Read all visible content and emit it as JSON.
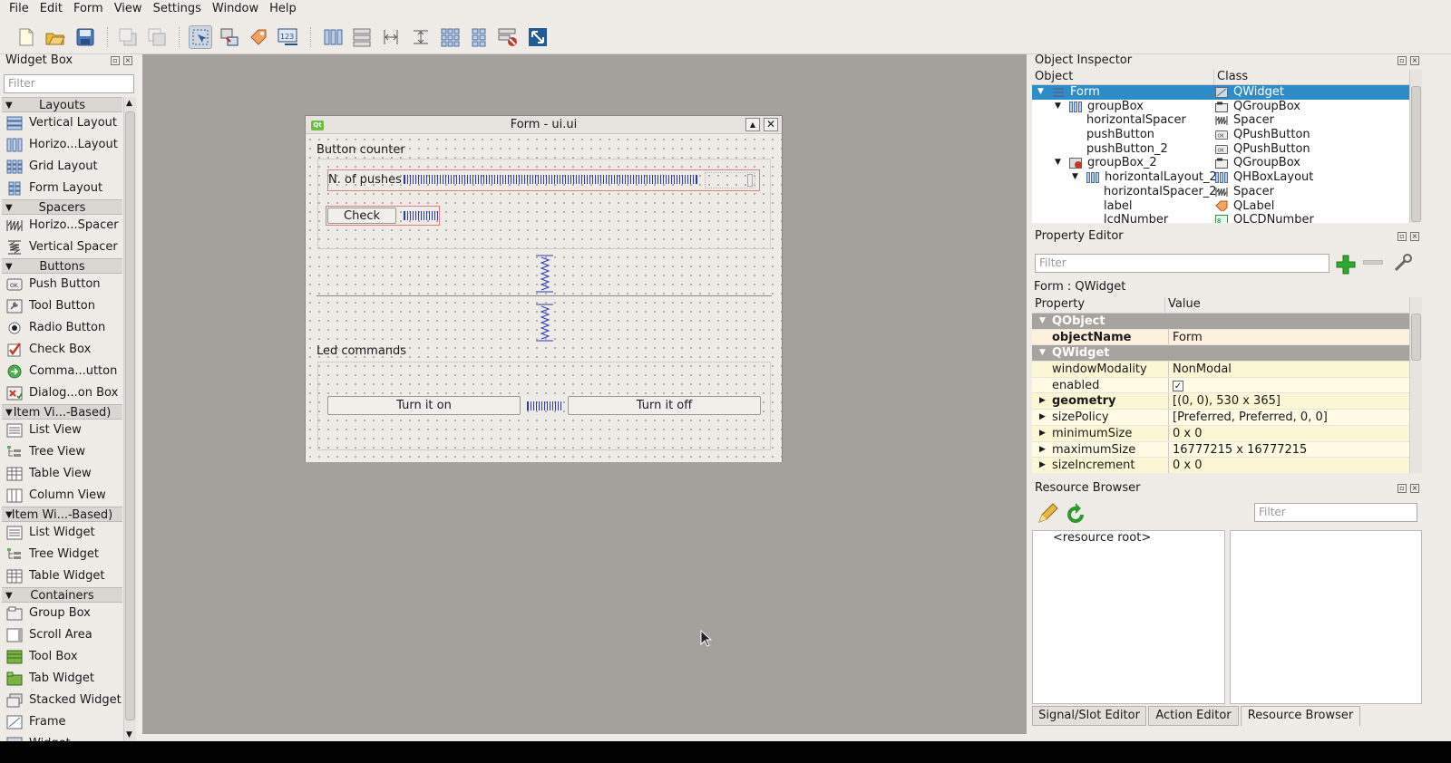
{
  "menubar": [
    "File",
    "Edit",
    "Form",
    "View",
    "Settings",
    "Window",
    "Help"
  ],
  "toolbar_icons": [
    "new-file-icon",
    "open-file-icon",
    "save-icon",
    "send-to-back-icon",
    "bring-to-front-icon",
    "edit-widgets-icon",
    "edit-signals-icon",
    "edit-buddies-icon",
    "edit-tab-order-icon",
    "layout-horizontal-icon",
    "layout-vertical-icon",
    "layout-h-splitter-icon",
    "layout-v-splitter-icon",
    "layout-grid-icon",
    "layout-form-icon",
    "break-layout-icon",
    "adjust-size-icon"
  ],
  "widget_box": {
    "title": "Widget Box",
    "filter_placeholder": "Filter",
    "categories": [
      {
        "label": "Layouts",
        "items": [
          "Vertical Layout",
          "Horizo...Layout",
          "Grid Layout",
          "Form Layout"
        ]
      },
      {
        "label": "Spacers",
        "items": [
          "Horizo...Spacer",
          "Vertical Spacer"
        ]
      },
      {
        "label": "Buttons",
        "items": [
          "Push Button",
          "Tool Button",
          "Radio Button",
          "Check Box",
          "Comma...utton",
          "Dialog...on Box"
        ]
      },
      {
        "label": "Item Vi...-Based)",
        "items": [
          "List View",
          "Tree View",
          "Table View",
          "Column View"
        ]
      },
      {
        "label": "Item Wi...-Based)",
        "items": [
          "List Widget",
          "Tree Widget",
          "Table Widget"
        ]
      },
      {
        "label": "Containers",
        "items": [
          "Group Box",
          "Scroll Area",
          "Tool Box",
          "Tab Widget",
          "Stacked Widget",
          "Frame",
          "Widget"
        ]
      }
    ]
  },
  "form": {
    "title": "Form - ui.ui",
    "group1_title": "Button counter",
    "label_pushes": "N. of pushes",
    "check_button": "Check",
    "group2_title": "Led commands",
    "turn_on_button": "Turn it on",
    "turn_off_button": "Turn it off"
  },
  "object_inspector": {
    "title": "Object Inspector",
    "col_object": "Object",
    "col_class": "Class",
    "rows": [
      {
        "name": "Form",
        "cls": "QWidget",
        "depth": 0,
        "expander": "▼",
        "selected": true
      },
      {
        "name": "groupBox",
        "cls": "QGroupBox",
        "depth": 1,
        "expander": "▼"
      },
      {
        "name": "horizontalSpacer",
        "cls": "Spacer",
        "depth": 2,
        "expander": ""
      },
      {
        "name": "pushButton",
        "cls": "QPushButton",
        "depth": 2,
        "expander": ""
      },
      {
        "name": "pushButton_2",
        "cls": "QPushButton",
        "depth": 2,
        "expander": ""
      },
      {
        "name": "groupBox_2",
        "cls": "QGroupBox",
        "depth": 1,
        "expander": "▼"
      },
      {
        "name": "horizontalLayout_2",
        "cls": "QHBoxLayout",
        "depth": 2,
        "expander": "▼"
      },
      {
        "name": "horizontalSpacer_2",
        "cls": "Spacer",
        "depth": 3,
        "expander": ""
      },
      {
        "name": "label",
        "cls": "QLabel",
        "depth": 3,
        "expander": ""
      },
      {
        "name": "lcdNumber",
        "cls": "QLCDNumber",
        "depth": 3,
        "expander": ""
      }
    ]
  },
  "property_editor": {
    "title": "Property Editor",
    "filter_placeholder": "Filter",
    "context": "Form : QWidget",
    "col_property": "Property",
    "col_value": "Value",
    "rows": [
      {
        "name": "QObject",
        "value": "",
        "kind": "grp"
      },
      {
        "name": "objectName",
        "value": "Form",
        "kind": "o1",
        "bold": true
      },
      {
        "name": "QWidget",
        "value": "",
        "kind": "grp"
      },
      {
        "name": "windowModality",
        "value": "NonModal",
        "kind": "y1"
      },
      {
        "name": "enabled",
        "value": "✓",
        "kind": "y2"
      },
      {
        "name": "geometry",
        "value": "[(0, 0), 530 x 365]",
        "kind": "y1",
        "bold": true,
        "exp": true
      },
      {
        "name": "sizePolicy",
        "value": "[Preferred, Preferred, 0, 0]",
        "kind": "y2",
        "exp": true
      },
      {
        "name": "minimumSize",
        "value": "0 x 0",
        "kind": "y1",
        "exp": true
      },
      {
        "name": "maximumSize",
        "value": "16777215 x 16777215",
        "kind": "y2",
        "exp": true
      },
      {
        "name": "sizeIncrement",
        "value": "0 x 0",
        "kind": "y1",
        "exp": true
      }
    ]
  },
  "resource_browser": {
    "title": "Resource Browser",
    "filter_placeholder": "Filter",
    "root": "<resource root>"
  },
  "bottom_tabs": [
    "Signal/Slot Editor",
    "Action Editor",
    "Resource Browser"
  ],
  "colors": {
    "selection": "#308cc6",
    "spacer": "#2b3ab8",
    "group_header": "#a7a39f"
  }
}
